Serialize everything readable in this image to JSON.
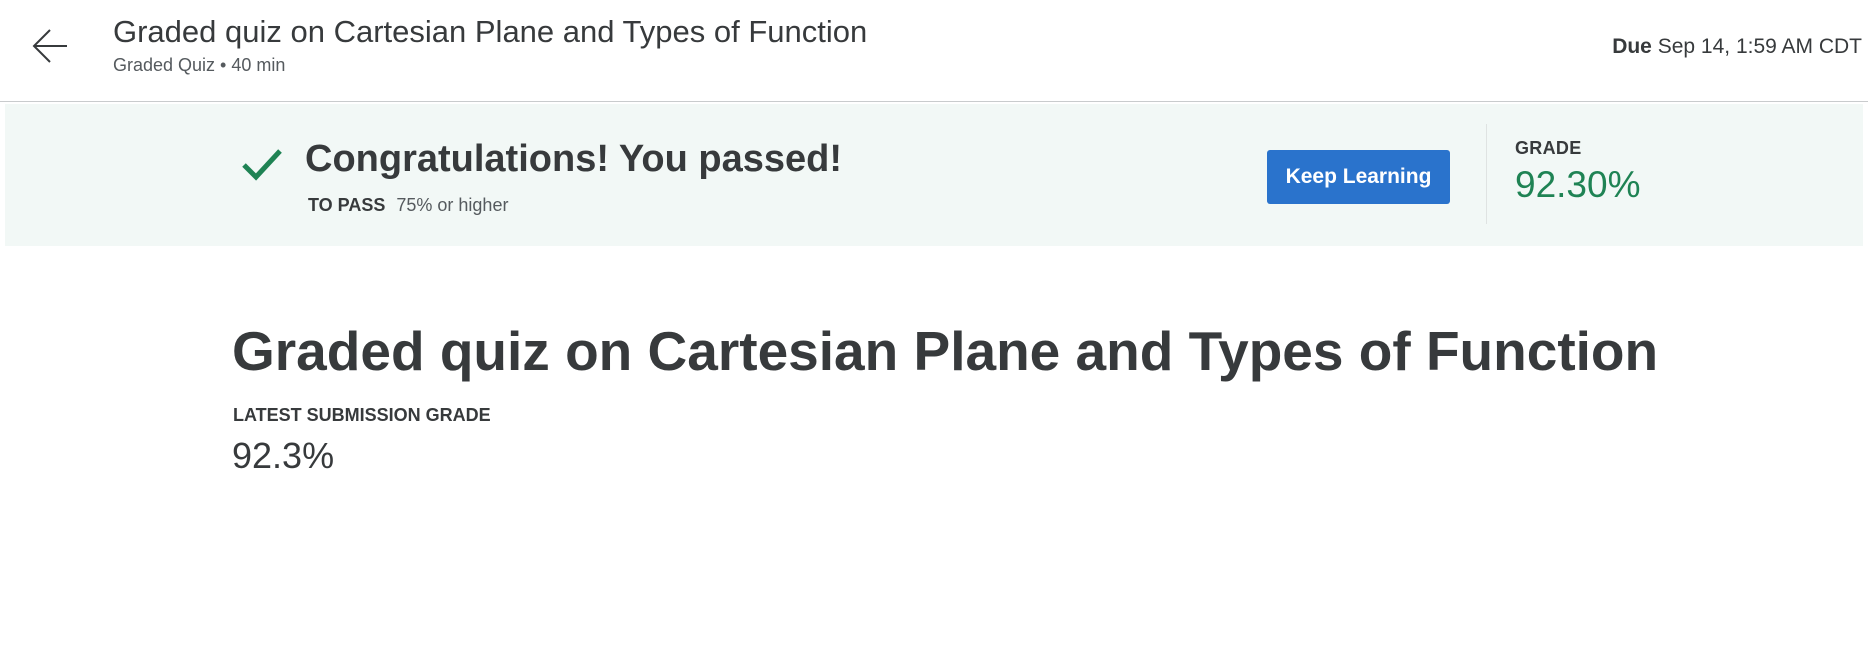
{
  "header": {
    "back_icon": "arrow-left-icon",
    "title": "Graded quiz on Cartesian Plane and Types of Function",
    "subtitle": "Graded Quiz • 40 min",
    "due_label": "Due",
    "due_value": "Sep 14, 1:59 AM CDT"
  },
  "banner": {
    "icon": "check-icon",
    "title": "Congratulations! You passed!",
    "pass_label": "TO PASS",
    "pass_value": "75% or higher",
    "button_label": "Keep Learning",
    "grade_label": "GRADE",
    "grade_value": "92.30%"
  },
  "main": {
    "title": "Graded quiz on Cartesian Plane and Types of Function",
    "latest_label": "LATEST SUBMISSION GRADE",
    "latest_value": "92.3%"
  },
  "colors": {
    "accent_blue": "#2a73cc",
    "success_green": "#1f8354",
    "banner_bg": "#f2f8f6",
    "text": "#373a3c"
  }
}
